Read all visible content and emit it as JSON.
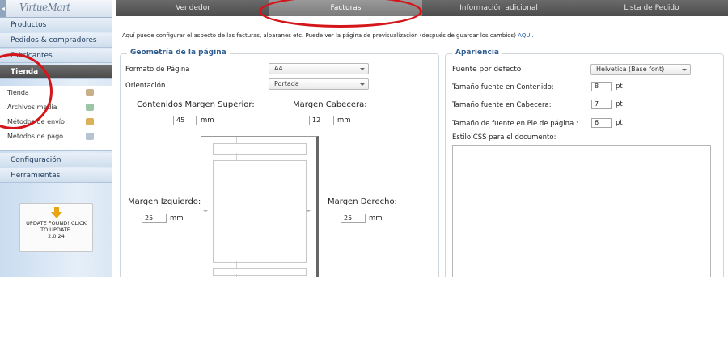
{
  "sidebar": {
    "logo": "VirtueMart",
    "logo_sub": "",
    "items": [
      {
        "label": "Productos"
      },
      {
        "label": "Pedidos & compradores"
      },
      {
        "label": "Fabricantes"
      },
      {
        "label": "Tienda"
      }
    ],
    "subitems": [
      {
        "label": "Tienda",
        "icon": "shop-icon"
      },
      {
        "label": "Archivos media",
        "icon": "media-icon"
      },
      {
        "label": "Métodos de envío",
        "icon": "truck-icon"
      },
      {
        "label": "Métodos de pago",
        "icon": "payment-icon"
      }
    ],
    "bottom_items": [
      {
        "label": "Configuración"
      },
      {
        "label": "Herramientas"
      }
    ],
    "update": {
      "text": "UPDATE FOUND! CLICK TO UPDATE.",
      "version": "2.0.24"
    }
  },
  "tabs": [
    {
      "label": "Vendedor"
    },
    {
      "label": "Facturas"
    },
    {
      "label": "Información adicional"
    },
    {
      "label": "Lista de Pedido"
    }
  ],
  "intro": {
    "text": "Aquí puede configurar el aspecto de las facturas, albaranes etc. Puede ver la página de previsualización (después de guardar los cambios)",
    "link": "AQUÍ."
  },
  "geometry": {
    "title": "Geometría de la página",
    "format_label": "Formato de Página",
    "format_value": "A4",
    "orientation_label": "Orientación",
    "orientation_value": "Portada",
    "top_margin_label": "Contenidos Margen Superior:",
    "top_margin_value": "45",
    "header_margin_label": "Margen Cabecera:",
    "header_margin_value": "12",
    "left_margin_label": "Margen Izquierdo:",
    "left_margin_value": "25",
    "right_margin_label": "Margen Derecho:",
    "right_margin_value": "25",
    "unit": "mm"
  },
  "appearance": {
    "title": "Apariencia",
    "font_label": "Fuente por defecto",
    "font_value": "Helvetica (Base font)",
    "content_size_label": "Tamaño fuente en Contenido:",
    "content_size_value": "8",
    "header_size_label": "Tamaño fuente en Cabecera:",
    "header_size_value": "7",
    "footer_size_label": "Tamaño de fuente en Pie de página :",
    "footer_size_value": "6",
    "unit": "pt",
    "css_label": "Estilo CSS para el documento:"
  },
  "colors": {
    "annotation": "#d4161b",
    "accent": "#2e5d90",
    "active_menu": "#555555"
  }
}
